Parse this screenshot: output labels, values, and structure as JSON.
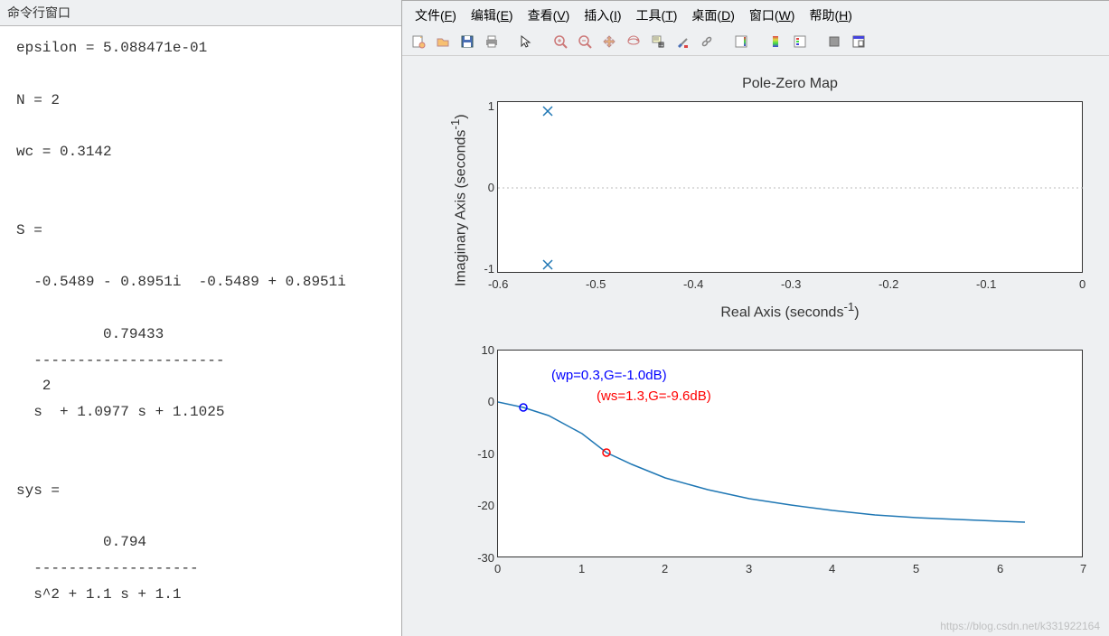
{
  "cmd": {
    "title": "命令行窗口",
    "lines": "epsilon = 5.088471e-01\n\nN = 2\n\nwc = 0.3142\n\n\nS =\n\n  -0.5489 - 0.8951i  -0.5489 + 0.8951i\n\n          0.79433\n  ----------------------\n   2\n  s  + 1.0977 s + 1.1025\n\n\nsys =\n\n          0.794\n  -------------------\n  s^2 + 1.1 s + 1.1\n"
  },
  "menu": {
    "file": "文件(F)",
    "edit": "编辑(E)",
    "view": "查看(V)",
    "insert": "插入(I)",
    "tools": "工具(T)",
    "desktop": "桌面(D)",
    "window": "窗口(W)",
    "help": "帮助(H)"
  },
  "toolbar_icons": [
    "new",
    "open",
    "save",
    "print",
    "arrow",
    "zoom-in",
    "zoom-out",
    "pan",
    "rotate",
    "datatip",
    "brush",
    "link",
    "colorbar",
    "legend",
    "insert",
    "dock"
  ],
  "chart_data": [
    {
      "type": "scatter",
      "title": "Pole-Zero Map",
      "xlabel": "Real Axis (seconds⁻¹)",
      "ylabel": "Imaginary Axis (seconds⁻¹)",
      "xlim": [
        -0.6,
        0
      ],
      "ylim": [
        -1,
        1
      ],
      "xticks": [
        -0.6,
        -0.5,
        -0.4,
        -0.3,
        -0.2,
        -0.1,
        0
      ],
      "yticks": [
        -1,
        0,
        1
      ],
      "series": [
        {
          "name": "poles",
          "marker": "x",
          "color": "#1f77b4",
          "x": [
            -0.5489,
            -0.5489
          ],
          "y": [
            0.8951,
            -0.8951
          ]
        }
      ]
    },
    {
      "type": "line",
      "title": "",
      "xlabel": "",
      "ylabel": "",
      "xlim": [
        0,
        7
      ],
      "ylim": [
        -30,
        10
      ],
      "xticks": [
        0,
        1,
        2,
        3,
        4,
        5,
        6,
        7
      ],
      "yticks": [
        -30,
        -20,
        -10,
        0,
        10
      ],
      "series": [
        {
          "name": "magnitude",
          "color": "#1f77b4",
          "x": [
            0,
            0.3,
            0.6,
            1.0,
            1.3,
            1.6,
            2.0,
            2.5,
            3.0,
            3.5,
            4.0,
            4.5,
            5.0,
            5.5,
            6.0,
            6.3
          ],
          "y": [
            0,
            -1.0,
            -2.5,
            -6.0,
            -9.6,
            -12.0,
            -14.5,
            -16.8,
            -18.5,
            -19.8,
            -20.8,
            -21.6,
            -22.2,
            -22.6,
            -22.9,
            -23.1
          ]
        }
      ],
      "markers": [
        {
          "x": 0.3,
          "y": -1.0,
          "color": "#0000ff",
          "label": "(wp=0.3,G=-1.0dB)"
        },
        {
          "x": 1.3,
          "y": -9.6,
          "color": "#ff0000",
          "label": "(ws=1.3,G=-9.6dB)"
        }
      ]
    }
  ],
  "annot": {
    "wp": "(wp=0.3,G=-1.0dB)",
    "ws": "(ws=1.3,G=-9.6dB)"
  },
  "watermark": "https://blog.csdn.net/k331922164"
}
